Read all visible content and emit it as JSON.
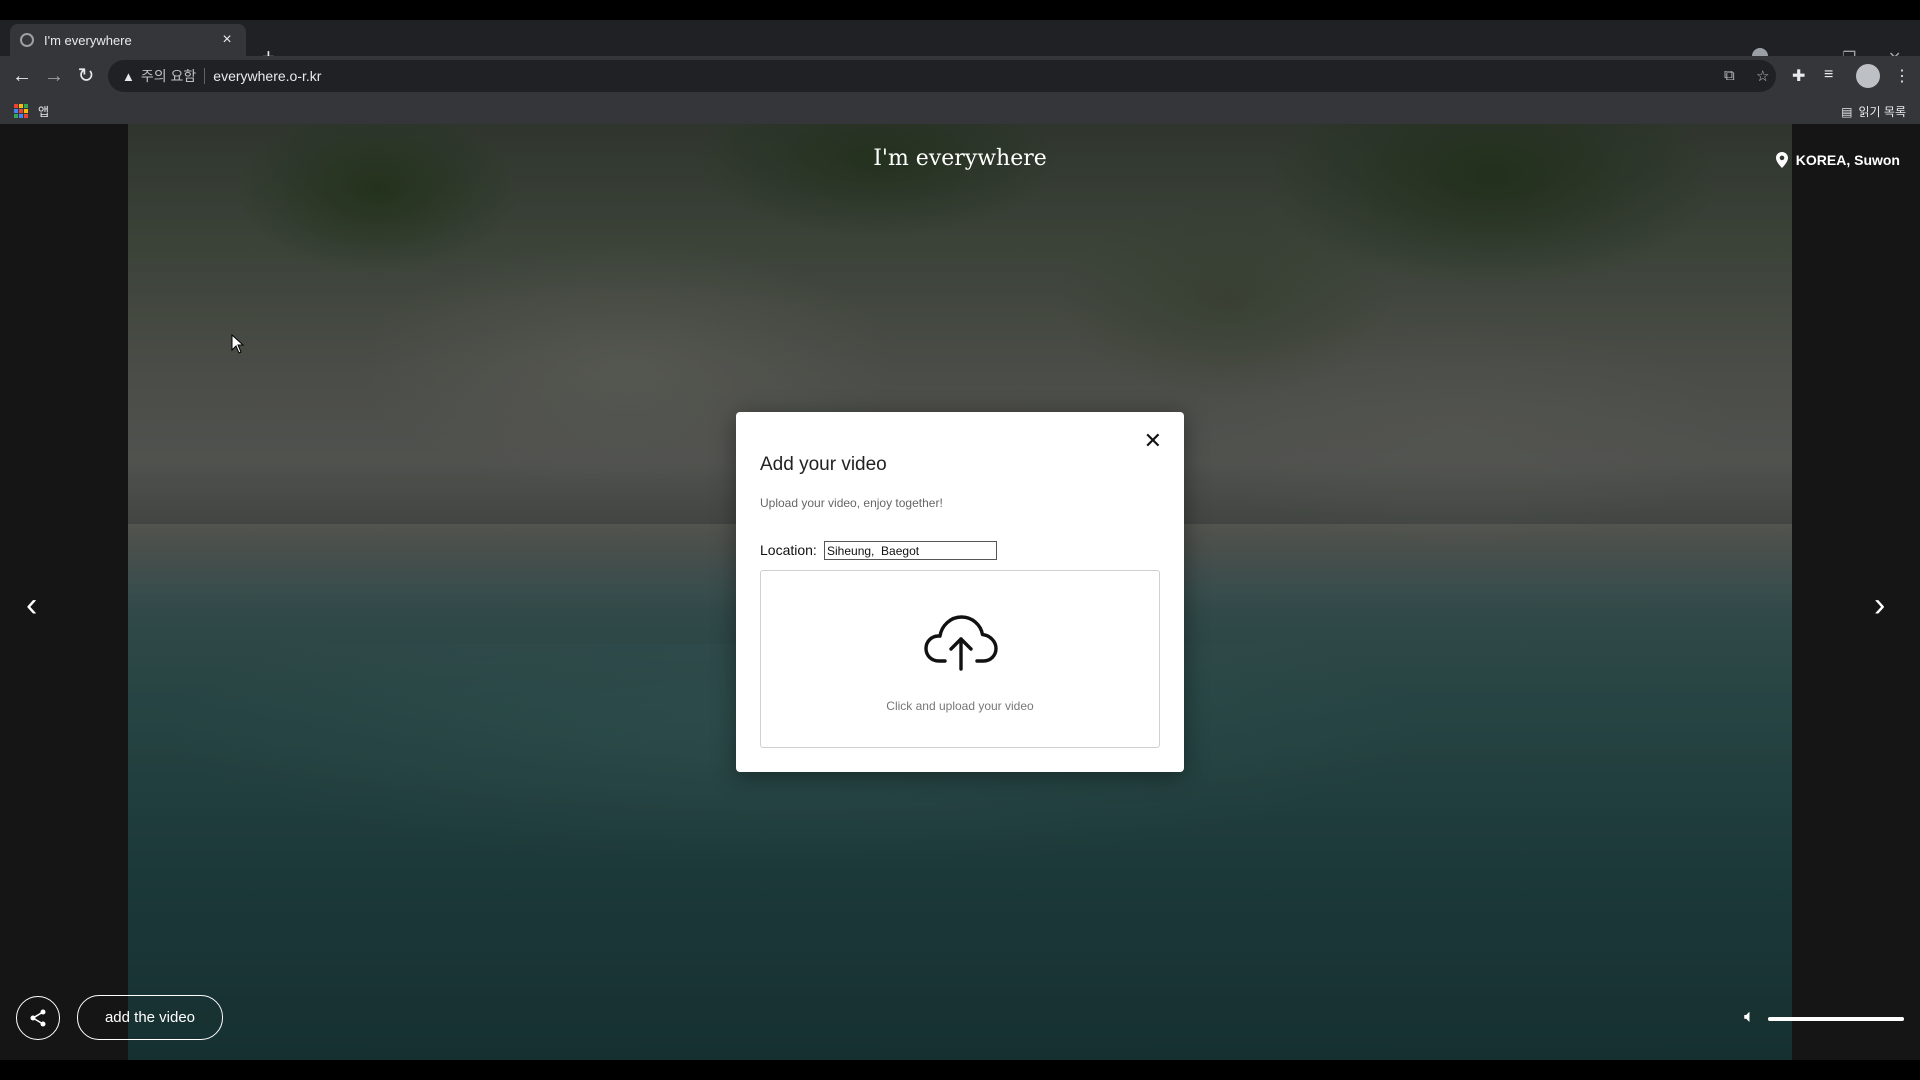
{
  "browser": {
    "tab_title": "I'm everywhere",
    "tab_close": "×",
    "new_tab": "+",
    "security_text": "주의 요함",
    "url": "everywhere.o-r.kr",
    "bookmarks_apps_label": "앱",
    "reading_list_label": "읽기 목록",
    "window_controls": [
      "—",
      "❐",
      "✕"
    ]
  },
  "page": {
    "site_title": "I'm everywhere",
    "location_tag": "KOREA, Suwon",
    "prev_arrow": "‹",
    "next_arrow": "›",
    "add_video_button": "add the video",
    "volume_level": 1.0
  },
  "modal": {
    "title": "Add your video",
    "subtitle": "Upload your video, enjoy together!",
    "location_label": "Location:",
    "location_value": "Siheung,  Baegot",
    "dropzone_label": "Click and upload your video",
    "close": "✕"
  },
  "colors": {
    "chrome_dark": "#202124",
    "chrome_toolbar": "#35363a",
    "modal_bg": "#ffffff"
  }
}
